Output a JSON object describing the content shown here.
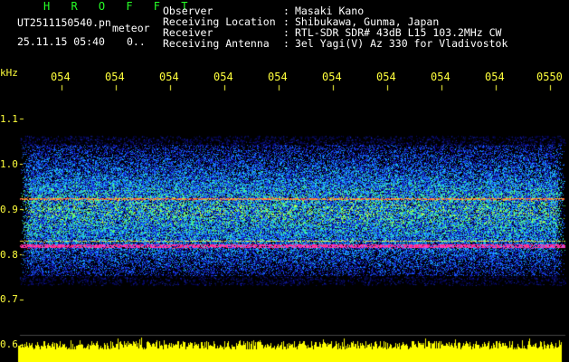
{
  "header": {
    "brand": "H R O F F T",
    "filename": "UT2511150540.pn",
    "tag": "meteor",
    "timestamp": "25.11.15 05:40",
    "count": "0.."
  },
  "info": [
    {
      "label": "Observer",
      "value": "Masaki Kano"
    },
    {
      "label": "Receiving Location",
      "value": "Shibukawa, Gunma, Japan"
    },
    {
      "label": "Receiver",
      "value": "RTL-SDR SDR# 43dB L15 103.2MHz CW"
    },
    {
      "label": "Receiving Antenna",
      "value": "3el Yagi(V) Az 330 for Vladivostok"
    }
  ],
  "axis": {
    "y_unit": "kHz",
    "y_ticks": [
      "1.1",
      "1.0",
      "0.9",
      "0.8",
      "0.7",
      "0.6"
    ],
    "x_ticks": [
      "054",
      "054",
      "054",
      "054",
      "054",
      "054",
      "054",
      "054",
      "054",
      "0550"
    ]
  },
  "colors": {
    "brand": "#27ff27",
    "axis": "#ffff3c",
    "text": "#ffffff",
    "background": "#000000"
  }
}
